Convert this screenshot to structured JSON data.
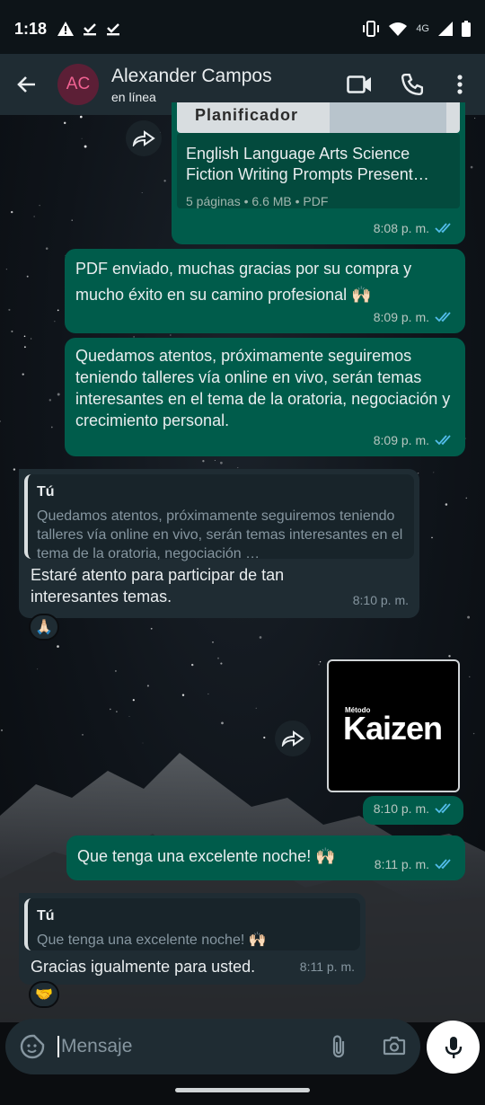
{
  "status_bar": {
    "time": "1:18",
    "network": "4G"
  },
  "header": {
    "avatar_initials": "AC",
    "contact_name": "Alexander Campos",
    "contact_status": "en línea"
  },
  "messages": {
    "doc": {
      "thumb_text": "Planificador",
      "title": "English Language Arts Science Fiction Writing Prompts Present…",
      "meta": "5 páginas • 6.6 MB • PDF",
      "time": "8:08 p. m."
    },
    "m1": {
      "text": "PDF enviado, muchas gracias por su compra y mucho éxito en su camino profesional 🙌🏻",
      "time": "8:09 p. m."
    },
    "m2": {
      "text": "Quedamos atentos, próximamente seguiremos teniendo talleres vía online en vivo, serán temas interesantes en el tema de la oratoria, negociación y crecimiento personal.",
      "time": "8:09 p. m."
    },
    "m3": {
      "quote_author": "Tú",
      "quote_text": "Quedamos atentos, próximamente seguiremos teniendo talleres vía online en vivo, serán temas interesantes en el tema de la oratoria, negociación …",
      "text": "Estaré atento para participar de tan interesantes temas.",
      "time": "8:10 p. m.",
      "reaction": "🙏🏻"
    },
    "img": {
      "small_text": "Método",
      "brand_text": "Kaizen",
      "time": "8:10 p. m."
    },
    "m4": {
      "text": "Que tenga una excelente noche! 🙌🏻",
      "time": "8:11 p. m."
    },
    "m5": {
      "quote_author": "Tú",
      "quote_text": "Que tenga una excelente noche! 🙌🏻",
      "text": "Gracias igualmente para usted.",
      "time": "8:11 p. m.",
      "reaction": "🤝"
    }
  },
  "composer": {
    "placeholder": "Mensaje"
  },
  "colors": {
    "outgoing_bubble": "#005c4b",
    "incoming_bubble": "#1f2c33",
    "header": "#1f2c33",
    "read_ticks": "#53bdeb"
  }
}
